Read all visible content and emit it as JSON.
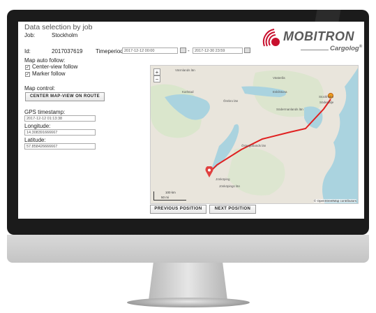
{
  "header": {
    "title": "Data selection by job",
    "job_label": "Job:",
    "job_value": "Stockholm",
    "id_label": "Id:",
    "id_value": "2017037619",
    "timeperiod_label": "Timeperiod:",
    "from_value": "2017-12-12 00:00",
    "separator": "-",
    "to_value": "2017-12-30 23:59"
  },
  "logo": {
    "brand": "MOBITRON",
    "product": "Cargolog",
    "registered": "®",
    "color": "#c8102e",
    "text_color": "#5a5a5a"
  },
  "map_follow": {
    "heading": "Map auto follow:",
    "center_view_label": "Center-view follow",
    "center_view_checked": true,
    "marker_label": "Marker follow",
    "marker_checked": true
  },
  "map_control": {
    "heading": "Map control:",
    "center_button": "CENTER MAP-VIEW ON ROUTE"
  },
  "gps": {
    "timestamp_label": "GPS timestamp:",
    "timestamp_value": "2017-12-12 01:13:38",
    "longitude_label": "Longitude:",
    "longitude_value": "14.308391666667",
    "latitude_label": "Latitude:",
    "latitude_value": "57.858426666667"
  },
  "map": {
    "zoom_in": "+",
    "zoom_out": "−",
    "labels": {
      "varmlands": "Värmlands län",
      "karlstad": "Karlstad",
      "vasteras": "Västerås",
      "eskilstuna": "Eskilstuna",
      "orebro": "Örebro län",
      "stockholm": "Stockholm",
      "sodertalje": "Södertälje",
      "sodermanlands": "Södermanlands län",
      "ostergotlands": "Östergötlands län",
      "jonkoping": "Jönköping",
      "jonkopings_lan": "Jönköpings län"
    },
    "scale_km": "100 km",
    "scale_mi": "50 mi",
    "attribution": "© OpenStreetMap contributors",
    "route_color": "#e02020",
    "water_color": "#aad3df",
    "land_color": "#e9e5dc",
    "forest_color": "#cfe3c0"
  },
  "buttons": {
    "previous": "PREVIOUS POSITION",
    "next": "NEXT POSITION"
  }
}
